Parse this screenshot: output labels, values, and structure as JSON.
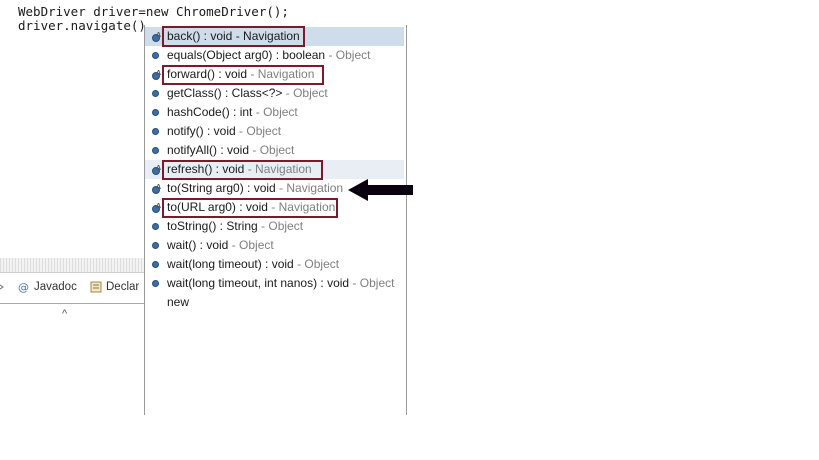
{
  "editor": {
    "line1": "WebDriver driver=new ChromeDriver();",
    "line2": "driver.navigate()."
  },
  "bottom_panel": {
    "tabs": [
      {
        "label": "Javadoc",
        "icon": "javadoc-icon"
      },
      {
        "label": "Declar",
        "icon": "declaration-icon"
      }
    ],
    "caret": "^"
  },
  "autocomplete": {
    "items": [
      {
        "signature": "back() : void",
        "owner": "Navigation",
        "icon": "method-icon",
        "selected": true
      },
      {
        "signature": "equals(Object arg0) : boolean",
        "owner": "Object",
        "icon": "method-icon"
      },
      {
        "signature": "forward() : void",
        "owner": "Navigation",
        "icon": "abstract-method-icon"
      },
      {
        "signature": "getClass() : Class<?>",
        "owner": "Object",
        "icon": "method-icon"
      },
      {
        "signature": "hashCode() : int",
        "owner": "Object",
        "icon": "method-icon"
      },
      {
        "signature": "notify() : void",
        "owner": "Object",
        "icon": "method-icon"
      },
      {
        "signature": "notifyAll() : void",
        "owner": "Object",
        "icon": "method-icon"
      },
      {
        "signature": "refresh() : void",
        "owner": "Navigation",
        "icon": "abstract-method-icon"
      },
      {
        "signature": "to(String arg0) : void",
        "owner": "Navigation",
        "icon": "abstract-method-icon"
      },
      {
        "signature": "to(URL arg0) : void",
        "owner": "Navigation",
        "icon": "abstract-method-icon"
      },
      {
        "signature": "toString() : String",
        "owner": "Object",
        "icon": "method-icon"
      },
      {
        "signature": "wait() : void",
        "owner": "Object",
        "icon": "method-icon"
      },
      {
        "signature": "wait(long timeout) : void",
        "owner": "Object",
        "icon": "method-icon"
      },
      {
        "signature": "wait(long timeout, int nanos) : void",
        "owner": "Object",
        "icon": "method-icon"
      },
      {
        "signature": "new",
        "owner": "",
        "icon": ""
      }
    ],
    "separator": " - "
  },
  "annotations": {
    "arrow_icon": "left-arrow-icon",
    "box_color": "#7a1a2a"
  }
}
